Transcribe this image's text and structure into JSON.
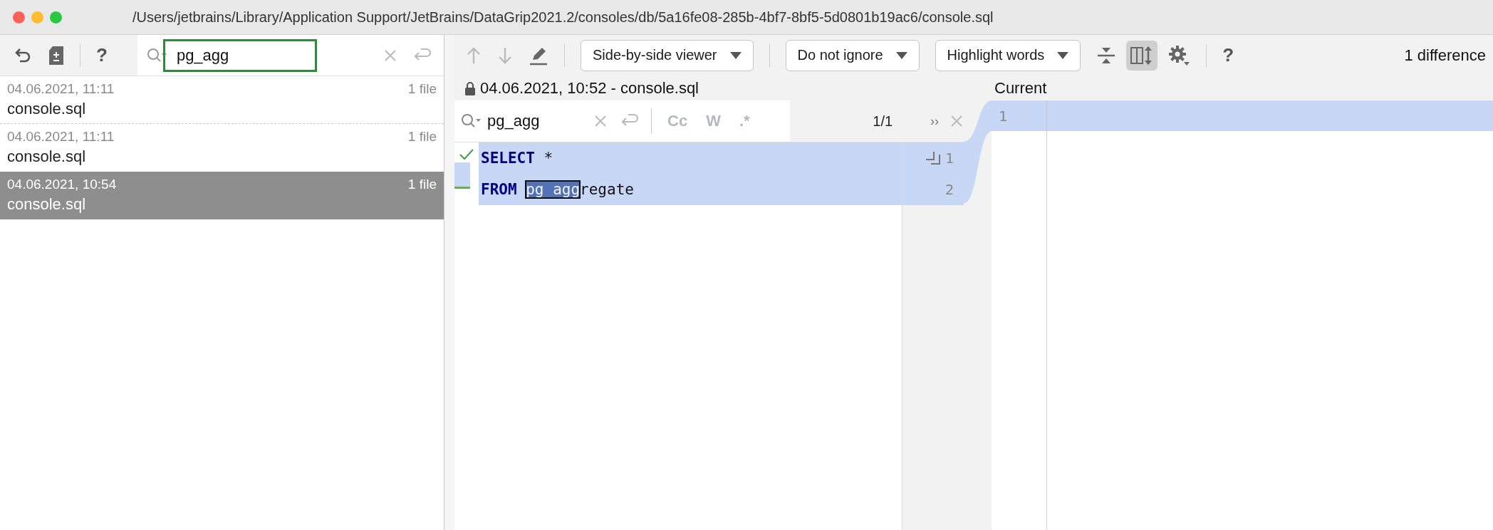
{
  "window": {
    "title": "/Users/jetbrains/Library/Application Support/JetBrains/DataGrip2021.2/consoles/db/5a16fe08-285b-4bf7-8bf5-5d0801b19ac6/console.sql"
  },
  "history_search": {
    "value": "pg_agg"
  },
  "history": [
    {
      "date": "04.06.2021, 11:11",
      "count": "1 file",
      "file": "console.sql",
      "selected": false
    },
    {
      "date": "04.06.2021, 11:11",
      "count": "1 file",
      "file": "console.sql",
      "selected": false
    },
    {
      "date": "04.06.2021, 10:54",
      "count": "1 file",
      "file": "console.sql",
      "selected": true
    }
  ],
  "diff_toolbar": {
    "dropdowns": [
      "Side-by-side viewer",
      "Do not ignore",
      "Highlight words"
    ],
    "toggles": [
      {
        "kind": "collapse",
        "selected": false
      },
      {
        "kind": "sync",
        "selected": true
      }
    ],
    "help": "?",
    "summary": "1 difference"
  },
  "left_pane": {
    "header": "04.06.2021, 10:52 - console.sql",
    "search": {
      "value": "pg_agg",
      "options": [
        "Cc",
        "W",
        ".*"
      ],
      "match_count": "1/1",
      "more": "››"
    },
    "lines": [
      {
        "number": "1",
        "tokens": [
          {
            "text": "SELECT",
            "kind": "keyword"
          },
          {
            "text": " *",
            "kind": "plain"
          }
        ]
      },
      {
        "number": "2",
        "tokens": [
          {
            "text": "FROM",
            "kind": "keyword"
          },
          {
            "text": "pg_agg",
            "kind": "match"
          },
          {
            "text": "regate",
            "kind": "plain"
          }
        ]
      }
    ]
  },
  "right_pane": {
    "header": "Current",
    "lines": [
      {
        "number": "1"
      }
    ]
  },
  "help": "?"
}
